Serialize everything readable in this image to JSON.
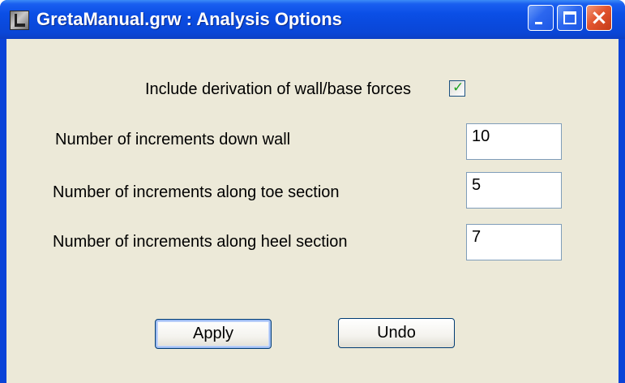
{
  "window": {
    "title": "GretaManual.grw : Analysis Options",
    "icon": "app-icon",
    "controls": [
      "minimize-icon",
      "maximize-icon",
      "close-icon"
    ]
  },
  "options": {
    "derivation_label": "Include derivation of wall/base forces",
    "derivation_checked": true
  },
  "increments": {
    "down_wall_label": "Number of increments down wall",
    "down_wall_value": "10",
    "toe_label": "Number of increments along toe section",
    "toe_value": "5",
    "heel_label": "Number of increments along heel section",
    "heel_value": "7"
  },
  "buttons": {
    "apply_label": "Apply",
    "undo_label": "Undo"
  },
  "colors": {
    "titlebar": "#0a49dc",
    "dialog_bg": "#ece9d8",
    "close_button": "#e2552f",
    "check": "#21a121"
  }
}
